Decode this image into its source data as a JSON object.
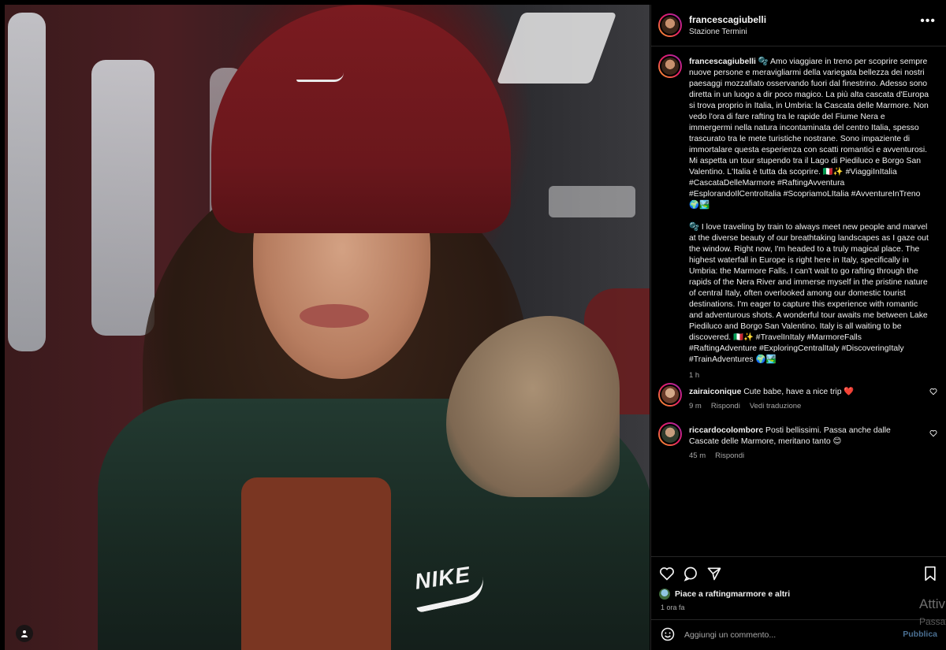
{
  "post": {
    "author": "francescagiubelli",
    "location": "Stazione Termini",
    "caption_it": "🫧 Amo viaggiare in treno per scoprire sempre nuove persone e meravigliarmi della variegata bellezza dei nostri paesaggi mozzafiato osservando fuori dal finestrino. Adesso sono diretta in un luogo a dir poco magico. La più alta cascata d'Europa si trova proprio in Italia, in Umbria: la Cascata delle Marmore. Non vedo l'ora di fare rafting tra le rapide del Fiume Nera e immergermi nella natura incontaminata del centro Italia, spesso trascurato tra le mete turistiche nostrane. Sono impaziente di immortalare questa esperienza con scatti romantici e avventurosi. Mi aspetta un tour stupendo tra il Lago di Piediluco e Borgo San Valentino. L'Italia è tutta da scoprire. 🇮🇹✨ #ViaggiInItalia #CascataDelleMarmore #RaftingAvventura #EsplorandoIlCentroItalia #ScopriamoLItalia #AvventureInTreno 🌍🏞️",
    "caption_en": "🫧 I love traveling by train to always meet new people and marvel at the diverse beauty of our breathtaking landscapes as I gaze out the window. Right now, I'm headed to a truly magical place. The highest waterfall in Europe is right here in Italy, specifically in Umbria: the Marmore Falls. I can't wait to go rafting through the rapids of the Nera River and immerse myself in the pristine nature of central Italy, often overlooked among our domestic tourist destinations. I'm eager to capture this experience with romantic and adventurous shots. A wonderful tour awaits me between Lake Piediluco and Borgo San Valentino. Italy is all waiting to be discovered. 🇮🇹✨ #TravelInItaly #MarmoreFalls #RaftingAdventure #ExploringCentralItaly #DiscoveringItaly #TrainAdventures 🌍🏞️",
    "caption_time": "1 h",
    "likes_text": "Piace a raftingmarmore e altri",
    "posted_ago": "1 ora fa"
  },
  "comments": [
    {
      "author": "zairaiconique",
      "text": "Cute babe, have a nice trip ❤️",
      "time": "9 m",
      "reply": "Rispondi",
      "translate": "Vedi traduzione"
    },
    {
      "author": "riccardocolomborc",
      "text": "Posti bellissimi. Passa anche dalle Cascate delle Marmore, meritano tanto 😊",
      "time": "45 m",
      "reply": "Rispondi"
    }
  ],
  "composer": {
    "placeholder": "Aggiungi un commento...",
    "publish_label": "Pubblica"
  },
  "watermark": {
    "line1": "Attiv",
    "line2": "Passa"
  },
  "icons": {
    "more": "more-horizontal-icon",
    "like": "heart-icon",
    "comment": "comment-icon",
    "share": "share-icon",
    "save": "bookmark-icon",
    "emoji": "emoji-icon",
    "user_tag": "user-tag-icon"
  },
  "colors": {
    "background": "#000000",
    "text": "#f5f5f5",
    "muted": "#a8a8a8",
    "publish": "#4a6f92",
    "heart_red": "#ed4956"
  }
}
